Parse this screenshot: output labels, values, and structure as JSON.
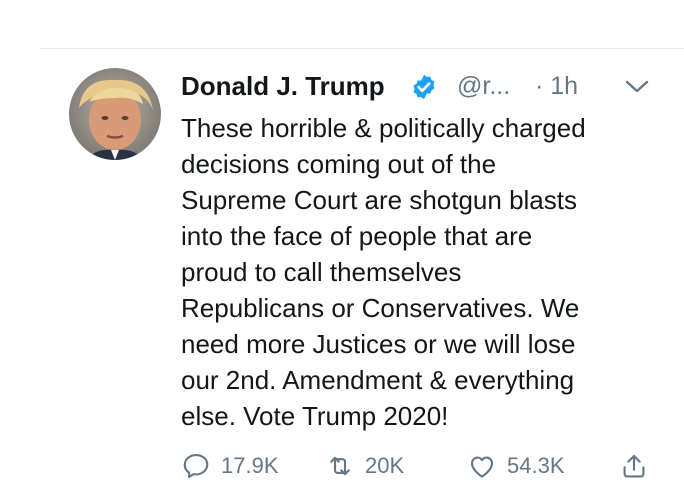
{
  "tweet": {
    "author": {
      "display_name": "Donald J. Trump",
      "handle": "@r...",
      "verified": true,
      "avatar_icon": "profile-photo"
    },
    "separator": "·",
    "time": "1h",
    "text_lines": [
      "These horrible & politically charged",
      "decisions coming out of the",
      "Supreme Court are shotgun blasts",
      "into the face of people that are",
      "proud to call themselves",
      "Republicans or Conservatives. We",
      "need more Justices or we will lose",
      "our 2nd. Amendment & everything",
      "else. Vote Trump 2020!"
    ],
    "actions": {
      "reply_count": "17.9K",
      "retweet_count": "20K",
      "like_count": "54.3K",
      "reply_icon": "reply-icon",
      "retweet_icon": "retweet-icon",
      "like_icon": "heart-icon",
      "share_icon": "share-icon"
    }
  },
  "colors": {
    "text_primary": "#14171a",
    "text_secondary": "#657786",
    "verified_blue": "#1da1f2",
    "divider": "#e1e8ed"
  }
}
